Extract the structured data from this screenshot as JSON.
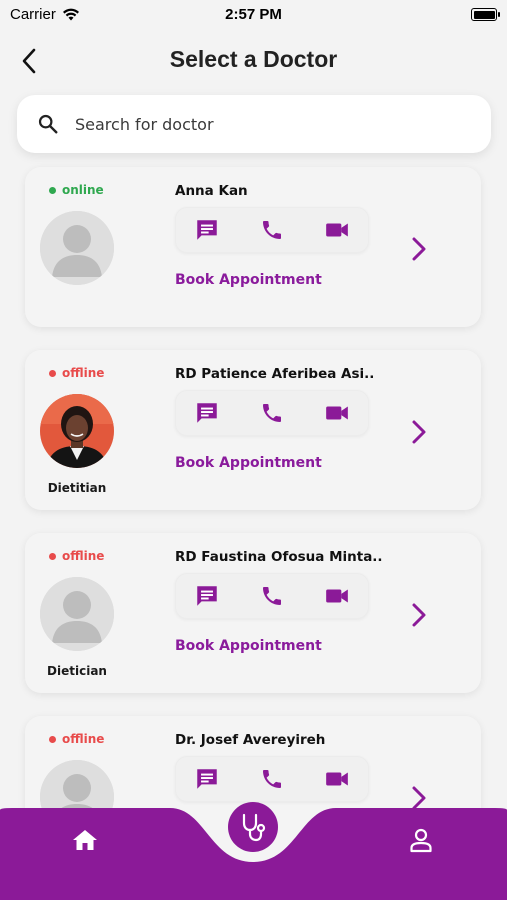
{
  "status_bar": {
    "carrier": "Carrier",
    "time": "2:57 PM"
  },
  "header": {
    "title": "Select a Doctor"
  },
  "search": {
    "placeholder": "Search for doctor"
  },
  "colors": {
    "accent": "#8b1a98",
    "online": "#2fa84f",
    "offline": "#e84b4b"
  },
  "book_label": "Book Appointment",
  "doctors": [
    {
      "status": "online",
      "name": "Anna Kan",
      "role": "",
      "avatar": "placeholder"
    },
    {
      "status": "offline",
      "name": "RD  Patience Aferibea Asi..",
      "role": "Dietitian",
      "avatar": "photo"
    },
    {
      "status": "offline",
      "name": "RD  Faustina Ofosua Minta..",
      "role": "Dietician",
      "avatar": "placeholder"
    },
    {
      "status": "offline",
      "name": "Dr.  Josef Avereyireh",
      "role": "",
      "avatar": "placeholder"
    }
  ],
  "icons": {
    "back": "chevron-left-icon",
    "search": "search-icon",
    "message": "message-icon",
    "phone": "phone-icon",
    "video": "video-icon",
    "chevron": "chevron-right-icon",
    "home": "home-icon",
    "stethoscope": "stethoscope-icon",
    "profile": "profile-icon"
  }
}
